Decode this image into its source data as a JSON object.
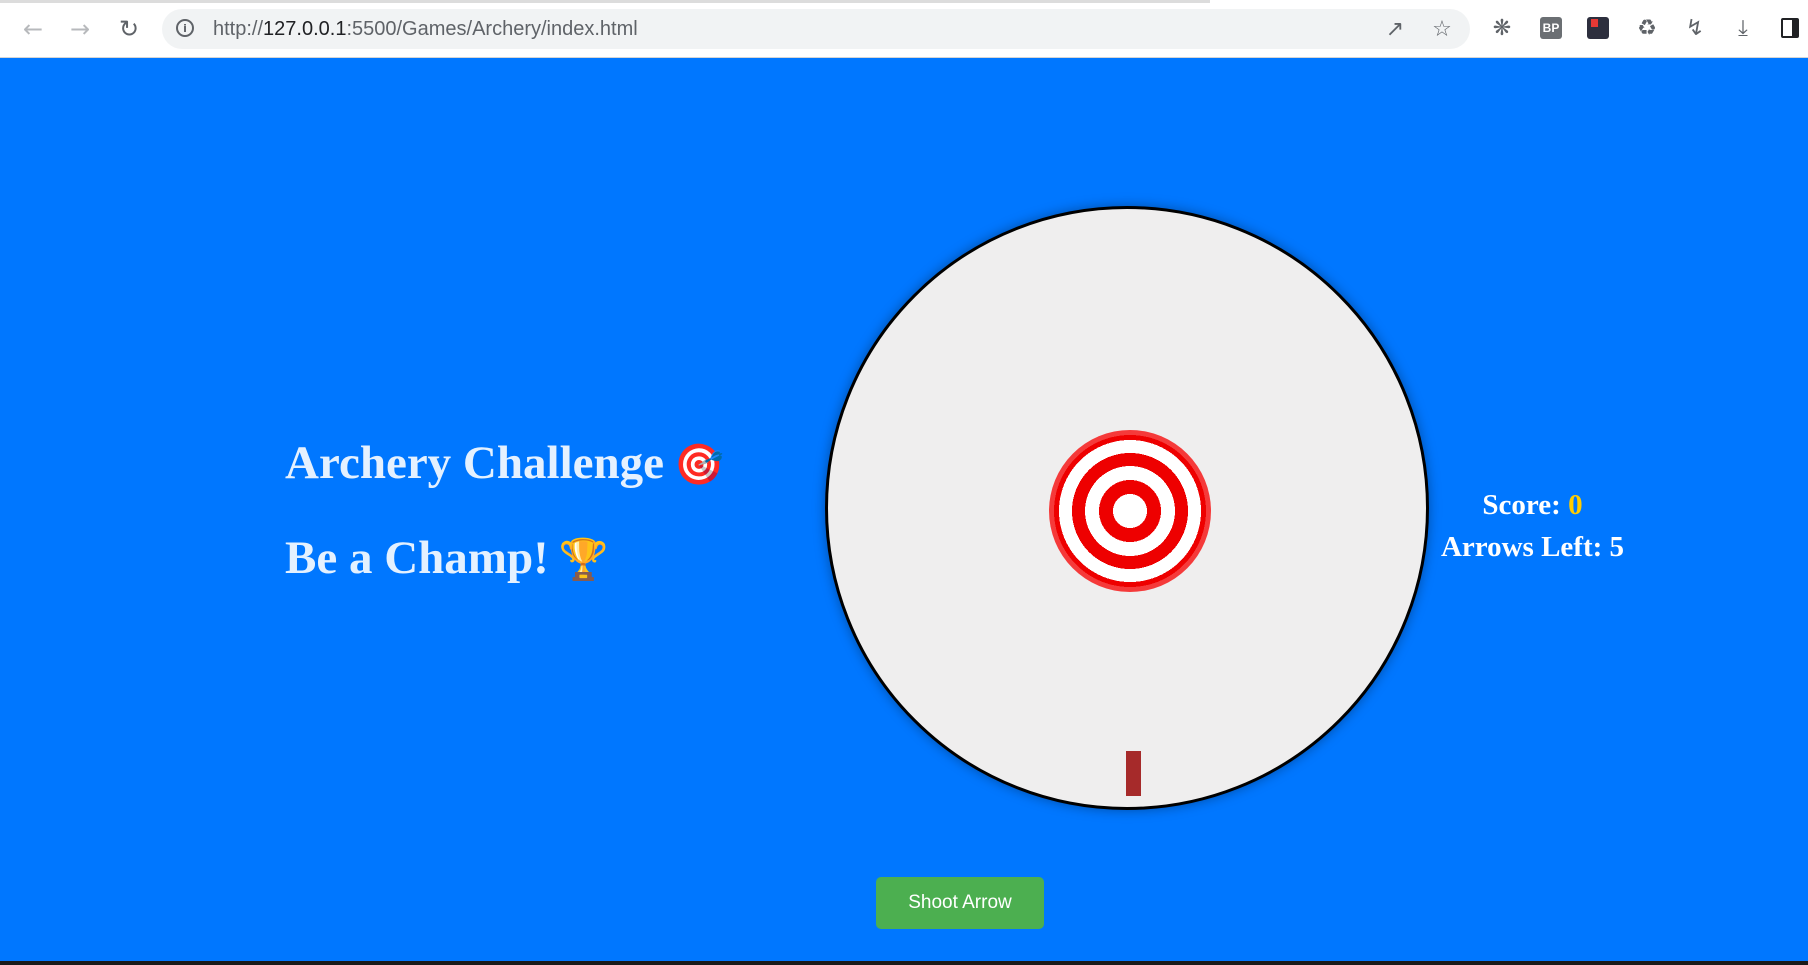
{
  "browser": {
    "url_prefix": "http://",
    "url_host": "127.0.0.1",
    "url_rest": ":5500/Games/Archery/index.html",
    "icons": {
      "back": "arrow-left",
      "forward": "arrow-right",
      "reload": "reload",
      "site_info": "info-circle",
      "share": "share",
      "bookmark": "star",
      "extensions": [
        "bug",
        "bp",
        "bookmark-red",
        "puzzle",
        "lightning-circle",
        "download",
        "side-panel"
      ]
    },
    "bp_label": "BP",
    "info_glyph": "i"
  },
  "page": {
    "background": "#0077ff",
    "heading1": "Archery Challenge",
    "heading1_emoji": "🎯",
    "heading2": "Be a Champ!",
    "heading2_emoji": "🏆",
    "score_label": "Score: ",
    "score_value": "0",
    "arrows_label": "Arrows Left: ",
    "arrows_value": "5",
    "shoot_button": "Shoot Arrow",
    "colors": {
      "button": "#4caf50",
      "score_value": "#ffcc00",
      "ring_red": "#ee0000",
      "arrow": "#a62a2a",
      "target_area": "#efeeee"
    }
  }
}
